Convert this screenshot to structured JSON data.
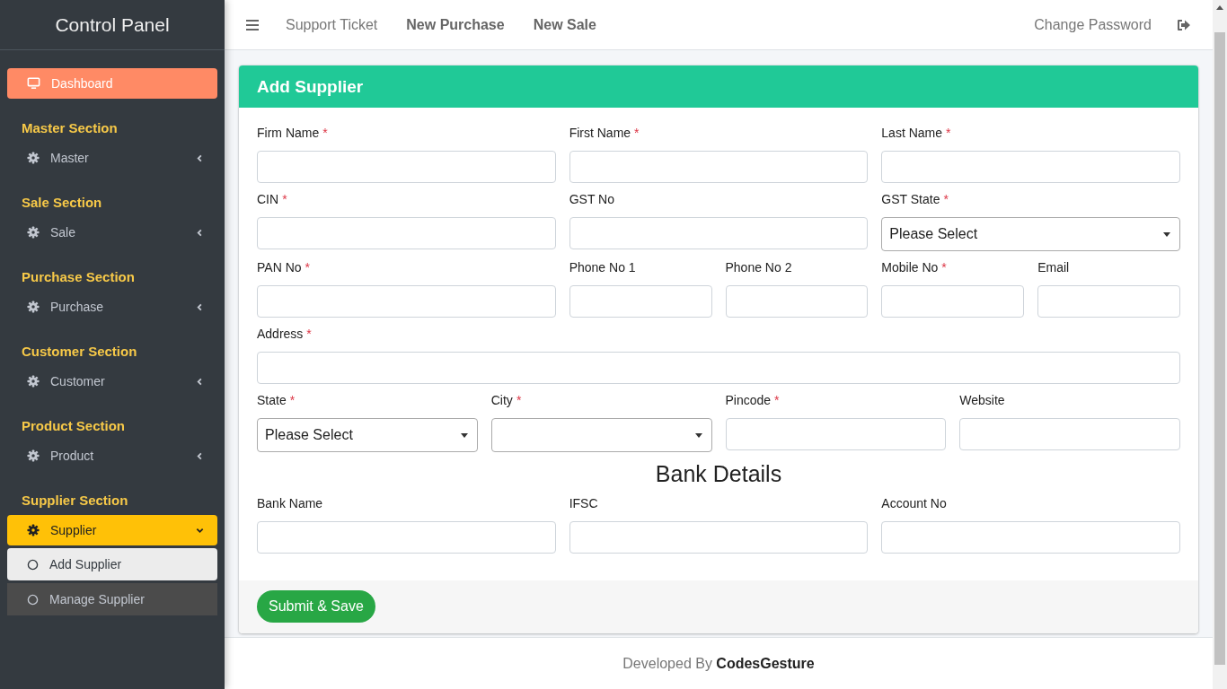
{
  "sidebar": {
    "title": "Control Panel",
    "dashboard": {
      "label": "Dashboard"
    },
    "sections": [
      {
        "heading": "Master Section",
        "item": {
          "label": "Master",
          "expanded": false
        }
      },
      {
        "heading": "Sale Section",
        "item": {
          "label": "Sale",
          "expanded": false
        }
      },
      {
        "heading": "Purchase Section",
        "item": {
          "label": "Purchase",
          "expanded": false
        }
      },
      {
        "heading": "Customer Section",
        "item": {
          "label": "Customer",
          "expanded": false
        }
      },
      {
        "heading": "Product Section",
        "item": {
          "label": "Product",
          "expanded": false
        }
      },
      {
        "heading": "Supplier Section",
        "item": {
          "label": "Supplier",
          "expanded": true,
          "children": [
            {
              "label": "Add Supplier",
              "selected": true
            },
            {
              "label": "Manage Supplier",
              "selected": false
            }
          ]
        }
      }
    ]
  },
  "topbar": {
    "links": [
      {
        "label": "Support Ticket",
        "emphasized": false
      },
      {
        "label": "New Purchase",
        "emphasized": true
      },
      {
        "label": "New Sale",
        "emphasized": true
      }
    ],
    "right_link": "Change Password"
  },
  "form": {
    "title": "Add Supplier",
    "fields": [
      {
        "label": "Firm Name",
        "required_mark": "*",
        "kind": "text"
      },
      {
        "label": "First Name",
        "required_mark": "*",
        "kind": "text"
      },
      {
        "label": "Last Name",
        "required_mark": "*",
        "kind": "text"
      },
      {
        "label": "CIN",
        "required_mark": "*",
        "kind": "text"
      },
      {
        "label": "GST No",
        "kind": "text"
      },
      {
        "label": "GST State",
        "required_mark": "*",
        "kind": "select",
        "value": "Please Select"
      },
      {
        "label": "PAN No",
        "required_mark": "*",
        "kind": "text"
      },
      {
        "label": "Phone No 1",
        "kind": "text"
      },
      {
        "label": "Phone No 2",
        "kind": "text"
      },
      {
        "label": "Mobile No",
        "required_mark": "*",
        "kind": "text"
      },
      {
        "label": "Email",
        "kind": "text"
      },
      {
        "label": "Address",
        "required_mark": "*",
        "kind": "text"
      },
      {
        "label": "State",
        "required_mark": "*",
        "kind": "select",
        "value": "Please Select"
      },
      {
        "label": "City",
        "required_mark": "*",
        "kind": "select"
      },
      {
        "label": "Pincode",
        "required_mark": "*",
        "kind": "text"
      },
      {
        "label": "Website",
        "kind": "text"
      }
    ],
    "bank_heading": "Bank Details",
    "bank_fields": [
      {
        "label": "Bank Name",
        "kind": "text"
      },
      {
        "label": "IFSC",
        "kind": "text"
      },
      {
        "label": "Account No",
        "kind": "text"
      }
    ],
    "submit": "Submit & Save"
  },
  "footer": {
    "prefix": "Developed By",
    "brand": "CodesGesture"
  }
}
